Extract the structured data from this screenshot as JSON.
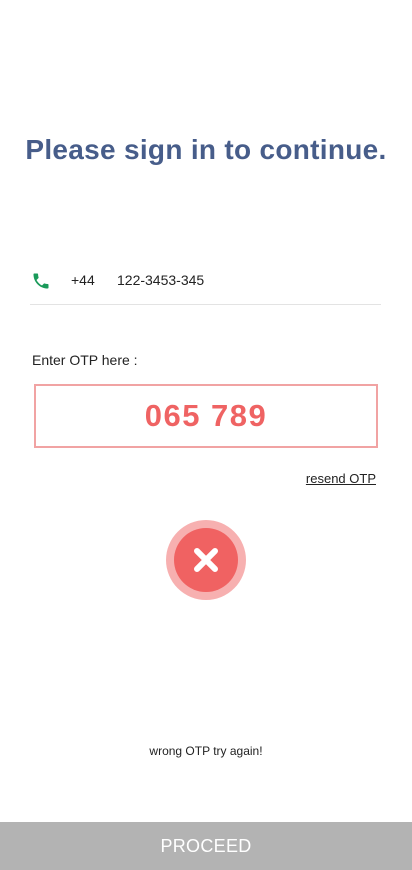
{
  "header": {
    "title": "Please sign in to continue."
  },
  "phone": {
    "icon": "phone-icon",
    "country_code": "+44",
    "number": "122-3453-345",
    "icon_color": "#1a9a5a"
  },
  "otp": {
    "label": "Enter OTP here :",
    "value": "065 789",
    "resend_label": "resend OTP",
    "accent_color": "#ef6363"
  },
  "status": {
    "icon": "error-close-icon",
    "message": "wrong OTP try again!"
  },
  "footer": {
    "proceed_label": "PROCEED"
  }
}
